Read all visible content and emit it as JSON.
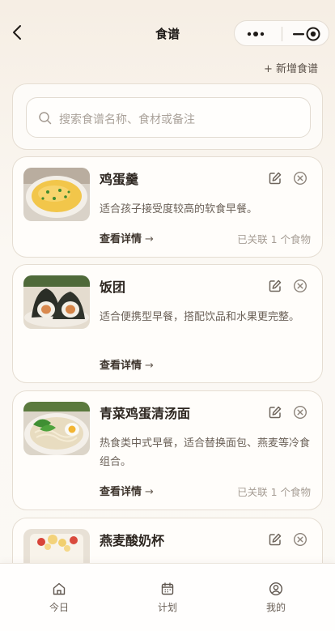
{
  "navbar": {
    "title": "食谱"
  },
  "header": {
    "add_label": "+ 新增食谱"
  },
  "search": {
    "placeholder": "搜索食谱名称、食材或备注"
  },
  "recipes": [
    {
      "name": "鸡蛋羹",
      "desc": "适合孩子接受度较高的软食早餐。",
      "detail_label": "查看详情",
      "linked": "已关联 1 个食物"
    },
    {
      "name": "饭团",
      "desc": "适合便携型早餐，搭配饮品和水果更完整。",
      "detail_label": "查看详情",
      "linked": ""
    },
    {
      "name": "青菜鸡蛋清汤面",
      "desc": "热食类中式早餐，适合替换面包、燕麦等冷食组合。",
      "detail_label": "查看详情",
      "linked": "已关联 1 个食物"
    },
    {
      "name": "燕麦酸奶杯",
      "desc": "",
      "detail_label": "",
      "linked": ""
    }
  ],
  "tabbar": {
    "items": [
      {
        "label": "今日",
        "icon": "home-icon"
      },
      {
        "label": "计划",
        "icon": "calendar-icon"
      },
      {
        "label": "我的",
        "icon": "user-icon"
      }
    ]
  },
  "colors": {
    "background": "#fbf8f3",
    "card_border": "#e5ddd2",
    "text_primary": "#2d2620",
    "text_secondary": "#6b6158",
    "text_muted": "#a69d94"
  }
}
